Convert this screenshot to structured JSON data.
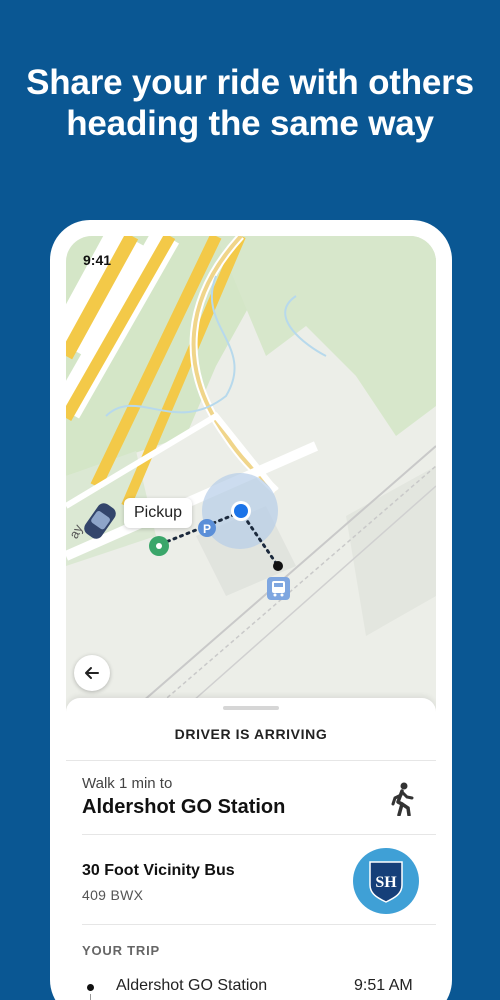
{
  "promo": {
    "headline_line1": "Share your ride with others",
    "headline_line2": "heading the same way"
  },
  "status_bar": {
    "time": "9:41"
  },
  "map": {
    "pickup_label": "Pickup",
    "road_label_partial": "ay",
    "icons": [
      "car-icon",
      "pickup-point-icon",
      "parking-icon",
      "user-location-icon",
      "bus-stop-icon",
      "back-arrow-icon"
    ]
  },
  "sheet": {
    "status": "DRIVER IS ARRIVING",
    "walk": {
      "label": "Walk 1 min to",
      "destination": "Aldershot GO Station",
      "icon": "walking-person-icon"
    },
    "bus": {
      "name": "30 Foot Vicinity Bus",
      "plate": "409 BWX",
      "logo_icon": "operator-logo-icon"
    },
    "trip": {
      "header": "YOUR TRIP",
      "stops": [
        {
          "name": "Aldershot GO Station",
          "time": "9:51 AM"
        }
      ]
    }
  },
  "colors": {
    "background": "#0a5793",
    "accent_blue": "#1a73e8",
    "pickup_green": "#3aa66a",
    "highway_yellow": "#f5c94a",
    "logo_circle": "#3fa0d6"
  }
}
